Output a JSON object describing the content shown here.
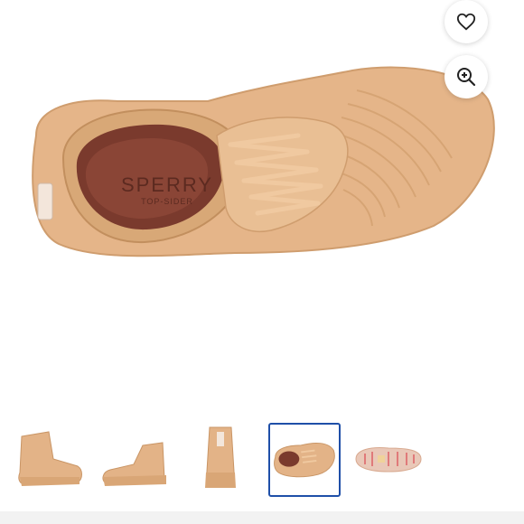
{
  "product": {
    "brand_text": "SPERRY",
    "subbrand_text": "TOP-SIDER"
  },
  "icons": {
    "favorite": "heart-icon",
    "zoom": "zoom-in-icon"
  },
  "colors": {
    "boot": "#e7b98a",
    "boot_shadow": "#c99565",
    "lining": "#7a3a2d",
    "selected_border": "#1f4fa8"
  },
  "gallery": {
    "thumbnails": [
      {
        "view": "side-high",
        "selected": false
      },
      {
        "view": "side-low",
        "selected": false
      },
      {
        "view": "back",
        "selected": false
      },
      {
        "view": "top",
        "selected": true
      },
      {
        "view": "sole",
        "selected": false
      }
    ]
  }
}
